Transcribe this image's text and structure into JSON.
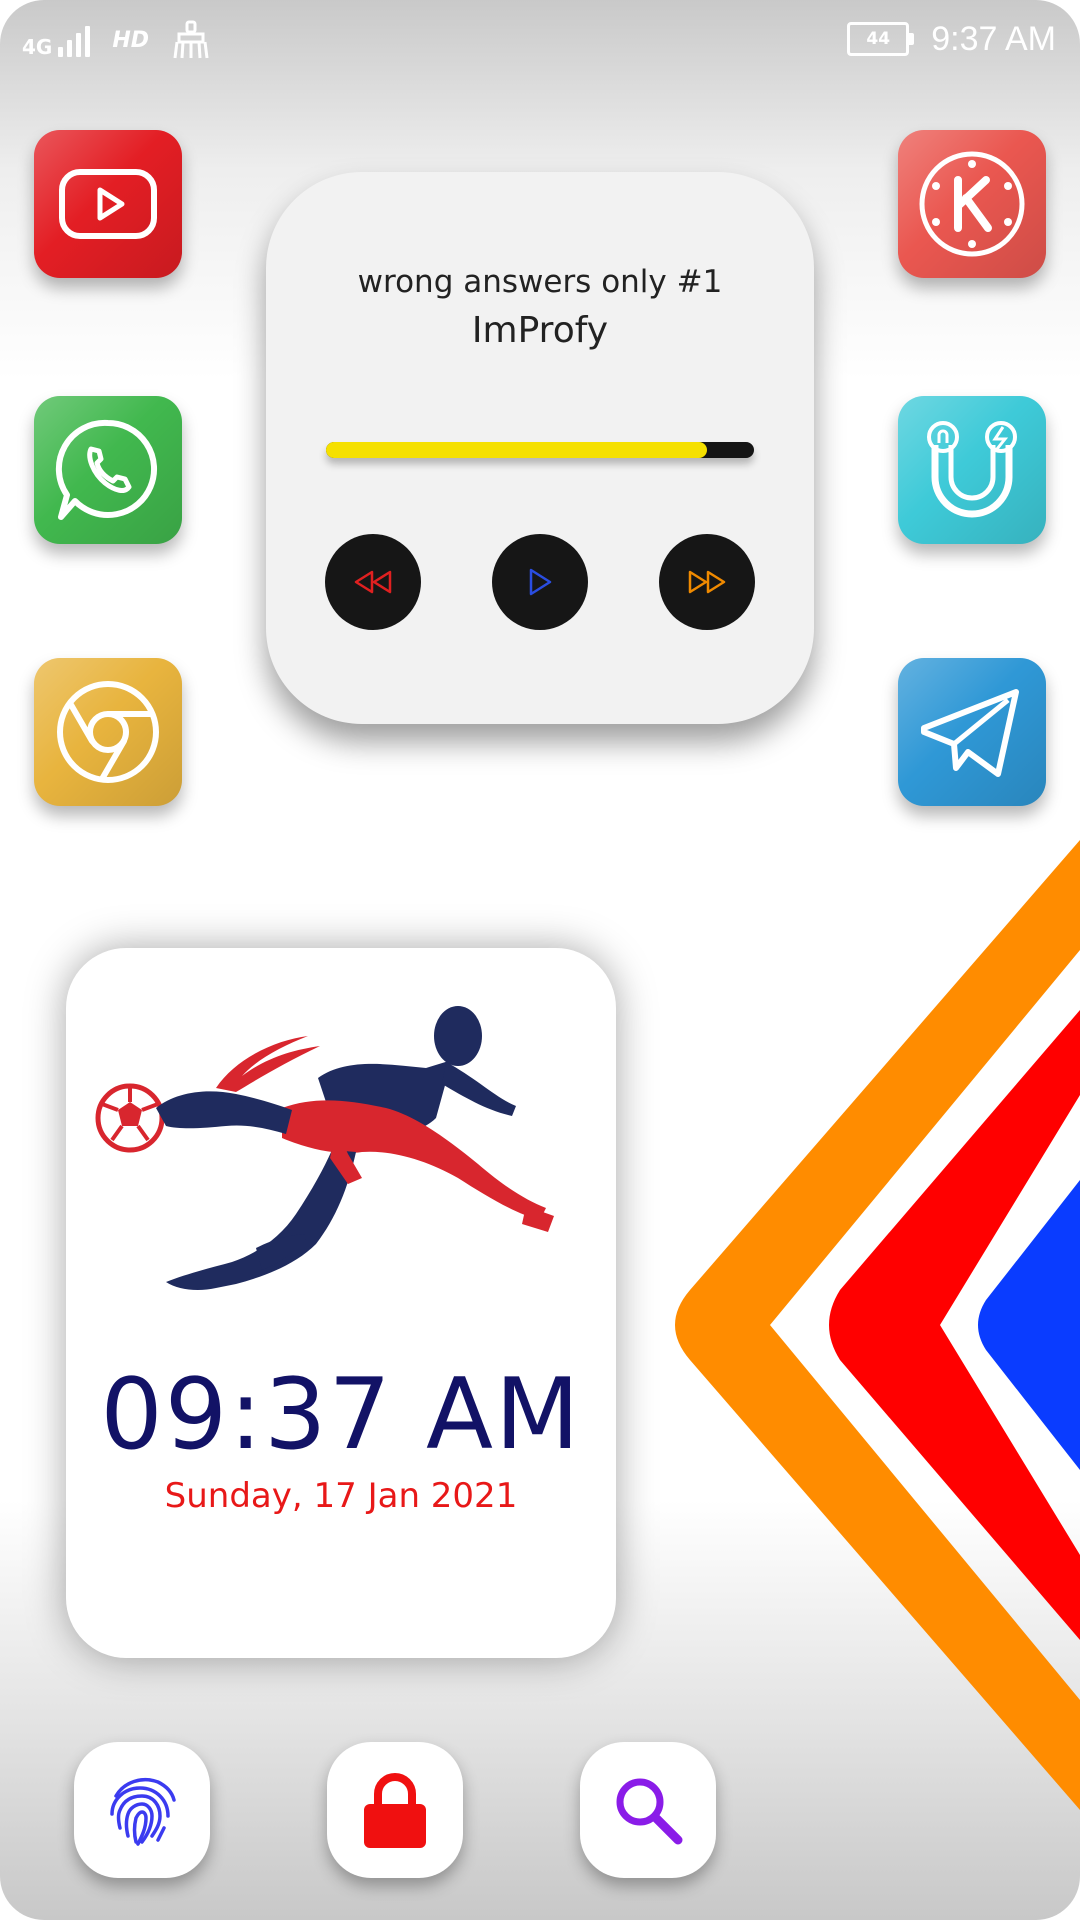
{
  "status_bar": {
    "network": "4G",
    "hd_label": "HD",
    "battery_level": "44",
    "time": "9:37 AM",
    "icons": [
      "signal-icon",
      "hd-icon",
      "cleaner-icon",
      "battery-icon"
    ]
  },
  "apps_left": [
    {
      "name": "youtube",
      "icon": "youtube-icon",
      "color": "#e52020"
    },
    {
      "name": "whatsapp",
      "icon": "whatsapp-icon",
      "color": "#3fb850"
    },
    {
      "name": "chrome",
      "icon": "chrome-icon",
      "color": "#e6b03c"
    }
  ],
  "apps_right": [
    {
      "name": "kinemaster",
      "icon": "kinemaster-icon",
      "color": "#ea5a52"
    },
    {
      "name": "energy-app",
      "icon": "magnet-bolt-icon",
      "color": "#3ecbd9"
    },
    {
      "name": "telegram",
      "icon": "telegram-icon",
      "color": "#2e9ad6"
    }
  ],
  "music_widget": {
    "title": "wrong answers only #1",
    "artist": "ImProfy",
    "progress": 0.89,
    "progress_color": "#f5e000",
    "controls": [
      "rewind-icon",
      "play-icon",
      "fast-forward-icon"
    ],
    "control_colors": {
      "rewind": "#e02020",
      "play": "#2a4de0",
      "fast_forward": "#f08a00"
    }
  },
  "clock_widget": {
    "time": "09:37 AM",
    "date": "Sunday, 17 Jan 2021",
    "image": "football-player-icon"
  },
  "dock": {
    "items": [
      "fingerprint-icon",
      "lock-icon",
      "search-icon"
    ],
    "colors": {
      "fingerprint": "#3b3bf0",
      "lock": "#f01010",
      "search": "#8a1ce8"
    }
  },
  "decoration_colors": {
    "orange": "#ff8c00",
    "red": "#ff0000",
    "blue": "#0a3cff"
  }
}
